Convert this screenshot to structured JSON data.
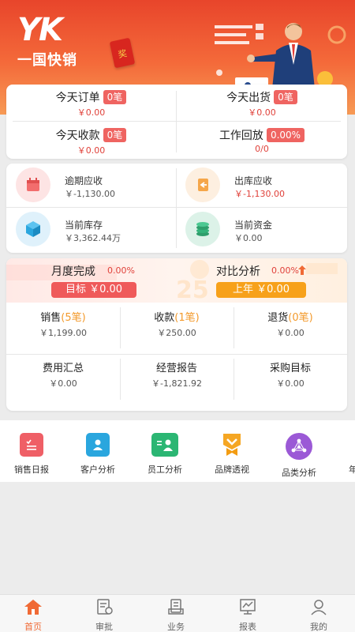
{
  "brand": {
    "logo_mark": "YK",
    "logo_text": "一国快销",
    "redpacket_char": "奖"
  },
  "summary": [
    {
      "label": "今天订单",
      "badge": "0笔",
      "value": "￥0.00"
    },
    {
      "label": "今天出货",
      "badge": "0笔",
      "value": "￥0.00"
    },
    {
      "label": "今天收款",
      "badge": "0笔",
      "value": "￥0.00"
    },
    {
      "label": "工作回放",
      "badge": "0.00%",
      "value": "0/0"
    }
  ],
  "finance": [
    {
      "label": "逾期应收",
      "value": "￥-1,130.00",
      "icon": "calendar-icon",
      "color": "#f26d6d"
    },
    {
      "label": "出库应收",
      "value": "￥-1,130.00",
      "icon": "outbound-icon",
      "color": "#f5a64a"
    },
    {
      "label": "当前库存",
      "value": "￥3,362.44万",
      "icon": "cube-icon",
      "color": "#2aa6de"
    },
    {
      "label": "当前资金",
      "value": "￥0.00",
      "icon": "coins-icon",
      "color": "#33b37a"
    }
  ],
  "monthly": {
    "title": "月度完成",
    "pct": "0.00%",
    "target": "目标 ￥0.00",
    "compare_title": "对比分析",
    "compare_pct": "0.00%",
    "last_year": "上年 ￥0.00",
    "watermark": "25"
  },
  "metrics": [
    {
      "label": "销售",
      "count": "(5笔)",
      "value": "￥1,199.00"
    },
    {
      "label": "收款",
      "count": "(1笔)",
      "value": "￥250.00"
    },
    {
      "label": "退货",
      "count": "(0笔)",
      "value": "￥0.00"
    },
    {
      "label": "费用汇总",
      "count": "",
      "value": "￥0.00"
    },
    {
      "label": "经营报告",
      "count": "",
      "value": "￥-1,821.92"
    },
    {
      "label": "采购目标",
      "count": "",
      "value": "￥0.00"
    }
  ],
  "shortcuts": [
    {
      "label": "销售日报",
      "icon": "sales-daily-icon",
      "color": "#ef5f66"
    },
    {
      "label": "客户分析",
      "icon": "customer-icon",
      "color": "#2aa6de"
    },
    {
      "label": "员工分析",
      "icon": "staff-icon",
      "color": "#2bb673"
    },
    {
      "label": "品牌透视",
      "icon": "brand-medal-icon",
      "color": "#f5a623"
    },
    {
      "label": "品类分析",
      "icon": "category-network-icon",
      "color": "#9b59d6"
    },
    {
      "label": "年",
      "icon": "more-icon",
      "color": "#999999"
    }
  ],
  "tabs": [
    {
      "label": "首页",
      "icon": "home-icon",
      "active": true
    },
    {
      "label": "审批",
      "icon": "approval-icon",
      "active": false
    },
    {
      "label": "业务",
      "icon": "business-icon",
      "active": false
    },
    {
      "label": "报表",
      "icon": "report-icon",
      "active": false
    },
    {
      "label": "我的",
      "icon": "profile-icon",
      "active": false
    }
  ],
  "colors": {
    "accent": "#f06a35",
    "header_top": "#e8452b",
    "alert_red": "#ef6461",
    "target_red": "#ef5a5a",
    "last_year_orange": "#f7a11a"
  }
}
